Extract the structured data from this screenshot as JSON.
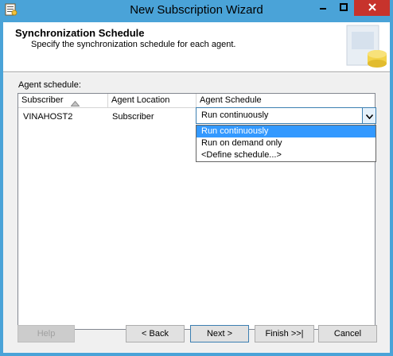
{
  "window": {
    "title": "New Subscription Wizard",
    "icons": {
      "app": "wizard-app-icon",
      "minimize": "minimize-icon",
      "maximize": "maximize-icon",
      "close": "close-icon"
    }
  },
  "header": {
    "title": "Synchronization Schedule",
    "subtitle": "Specify the synchronization schedule for each agent."
  },
  "agent_schedule": {
    "label": "Agent schedule:",
    "columns": [
      "Subscriber",
      "Agent Location",
      "Agent Schedule"
    ],
    "sort_icon": "sort-ascending-icon",
    "rows": [
      {
        "subscriber": "VINAHOST2",
        "location": "Subscriber",
        "schedule": "Run continuously"
      }
    ],
    "dropdown_options": [
      "Run continuously",
      "Run on demand only",
      "<Define schedule...>"
    ],
    "selected_option": "Run continuously"
  },
  "buttons": {
    "help": "Help",
    "back": "< Back",
    "next": "Next >",
    "finish": "Finish >>|",
    "cancel": "Cancel"
  },
  "colors": {
    "titlebar": "#4aa3d8",
    "close_button": "#c7332c",
    "selection": "#3399ff"
  }
}
